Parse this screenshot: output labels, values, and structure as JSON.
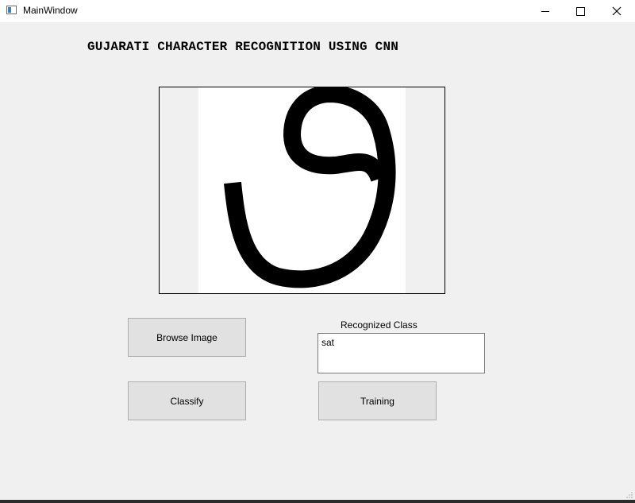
{
  "window": {
    "title": "MainWindow",
    "icon": "app-window-icon",
    "controls": [
      "minimize-icon",
      "maximize-icon",
      "close-icon"
    ]
  },
  "main": {
    "heading": "GUJARATI CHARACTER RECOGNITION USING CNN",
    "image": "handwritten Gujarati character",
    "buttons": {
      "browse": "Browse Image",
      "classify": "Classify",
      "training": "Training"
    },
    "result": {
      "label": "Recognized Class",
      "value": "sat"
    }
  },
  "colors": {
    "window_bg": "#f0f0f0",
    "titlebar_bg": "#ffffff",
    "button_bg": "#e1e1e1",
    "button_border": "#adadad"
  }
}
